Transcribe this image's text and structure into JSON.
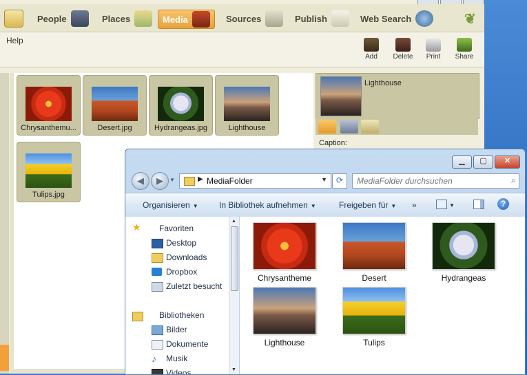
{
  "app": {
    "nav": [
      {
        "label": "People"
      },
      {
        "label": "Places"
      },
      {
        "label": "Media"
      },
      {
        "label": "Sources"
      },
      {
        "label": "Publish"
      },
      {
        "label": "Web Search"
      }
    ],
    "active_tab": "Media",
    "menu": {
      "help": "Help"
    },
    "actions": {
      "add": "Add",
      "delete": "Delete",
      "print": "Print",
      "share": "Share"
    },
    "media_items": [
      {
        "caption": "Chrysanthemu..."
      },
      {
        "caption": "Desert.jpg"
      },
      {
        "caption": "Hydrangeas.jpg"
      },
      {
        "caption": "Lighthouse"
      },
      {
        "caption": "Tulips.jpg"
      }
    ],
    "detail": {
      "title": "Lighthouse",
      "caption_label": "Caption:"
    }
  },
  "explorer": {
    "address": {
      "folder": "MediaFolder"
    },
    "search": {
      "placeholder": "MediaFolder durchsuchen"
    },
    "commands": {
      "organize": "Organisieren",
      "include_library": "In Bibliothek aufnehmen",
      "share_with": "Freigeben für",
      "more": "»"
    },
    "nav": {
      "favorites_label": "Favoriten",
      "favorites": [
        "Desktop",
        "Downloads",
        "Dropbox",
        "Zuletzt besucht"
      ],
      "libraries_label": "Bibliotheken",
      "libraries": [
        "Bilder",
        "Dokumente",
        "Musik",
        "Videos"
      ]
    },
    "files": [
      {
        "name": "Chrysantheme"
      },
      {
        "name": "Desert"
      },
      {
        "name": "Hydrangeas"
      },
      {
        "name": "Lighthouse"
      },
      {
        "name": "Tulips"
      }
    ]
  }
}
